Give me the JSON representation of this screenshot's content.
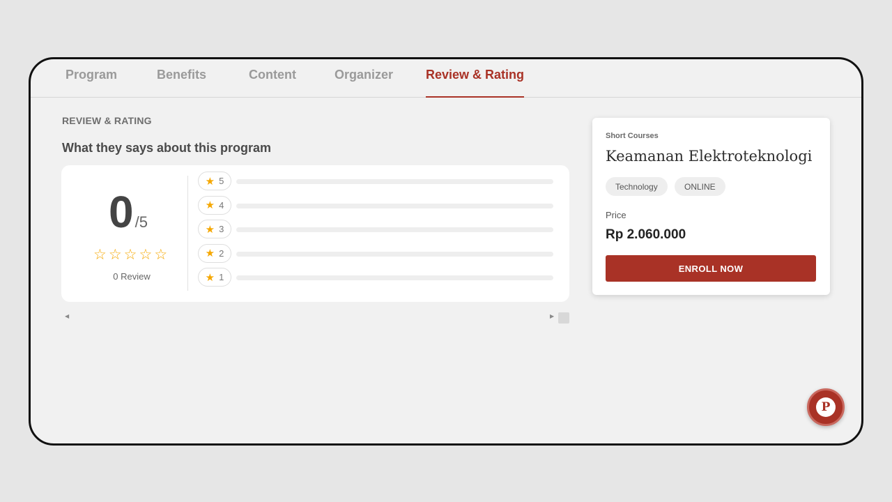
{
  "tabs": [
    {
      "label": "Program",
      "active": false
    },
    {
      "label": "Benefits",
      "active": false
    },
    {
      "label": "Content",
      "active": false
    },
    {
      "label": "Organizer",
      "active": false
    },
    {
      "label": "Review & Rating",
      "active": true
    }
  ],
  "review": {
    "section_label": "REVIEW & RATING",
    "section_title": "What they says about this program",
    "score": "0",
    "score_max": "/5",
    "stars_filled": 0,
    "stars_total": 5,
    "review_count": "0 Review",
    "rows": [
      {
        "star": "5",
        "fraction": 0
      },
      {
        "star": "4",
        "fraction": 0
      },
      {
        "star": "3",
        "fraction": 0
      },
      {
        "star": "2",
        "fraction": 0
      },
      {
        "star": "1",
        "fraction": 0
      }
    ]
  },
  "course": {
    "category": "Short Courses",
    "title": "Keamanan Elektroteknologi",
    "tags": [
      "Technology",
      "ONLINE"
    ],
    "price_label": "Price",
    "price": "Rp 2.060.000",
    "enroll_label": "ENROLL NOW"
  },
  "fab": {
    "letter": "P"
  },
  "colors": {
    "accent": "#a93226",
    "star": "#f5a700"
  }
}
